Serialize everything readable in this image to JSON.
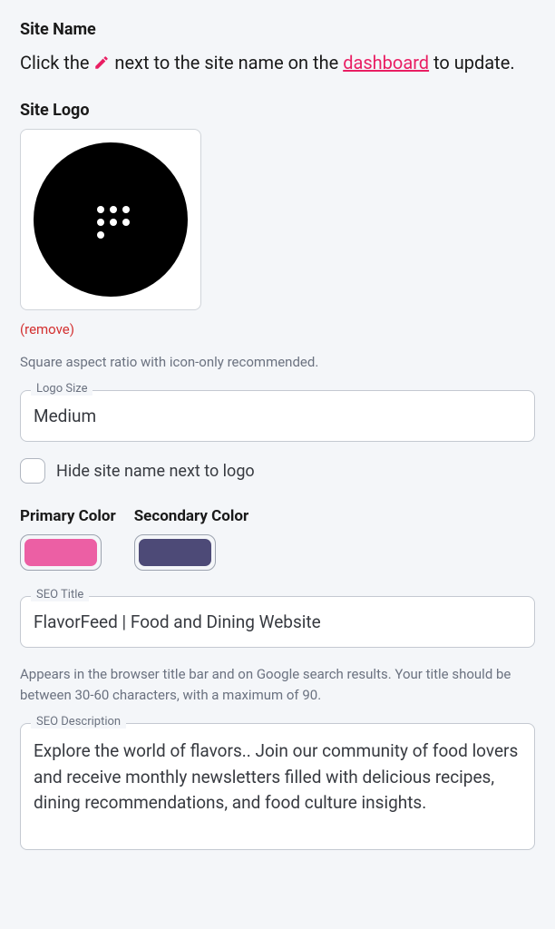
{
  "siteName": {
    "label": "Site Name",
    "help_prefix": "Click the ",
    "help_mid": " next to the site name on the ",
    "dashboard_link": "dashboard",
    "help_suffix": " to update."
  },
  "siteLogo": {
    "label": "Site Logo",
    "remove": "(remove)",
    "help": "Square aspect ratio with icon-only recommended.",
    "size_label": "Logo Size",
    "size_value": "Medium"
  },
  "hideName": {
    "label": "Hide site name next to logo"
  },
  "colors": {
    "primary_label": "Primary Color",
    "secondary_label": "Secondary Color",
    "primary_value": "#ec5fa4",
    "secondary_value": "#4d4a77"
  },
  "seo": {
    "title_label": "SEO Title",
    "title_value": "FlavorFeed | Food and Dining Website",
    "title_help": "Appears in the browser title bar and on Google search results. Your title should be between 30-60 characters, with a maximum of 90.",
    "desc_label": "SEO Description",
    "desc_value": "Explore the world of flavors.. Join our community of food lovers and receive monthly newsletters filled with delicious recipes, dining recommendations, and food culture insights."
  }
}
